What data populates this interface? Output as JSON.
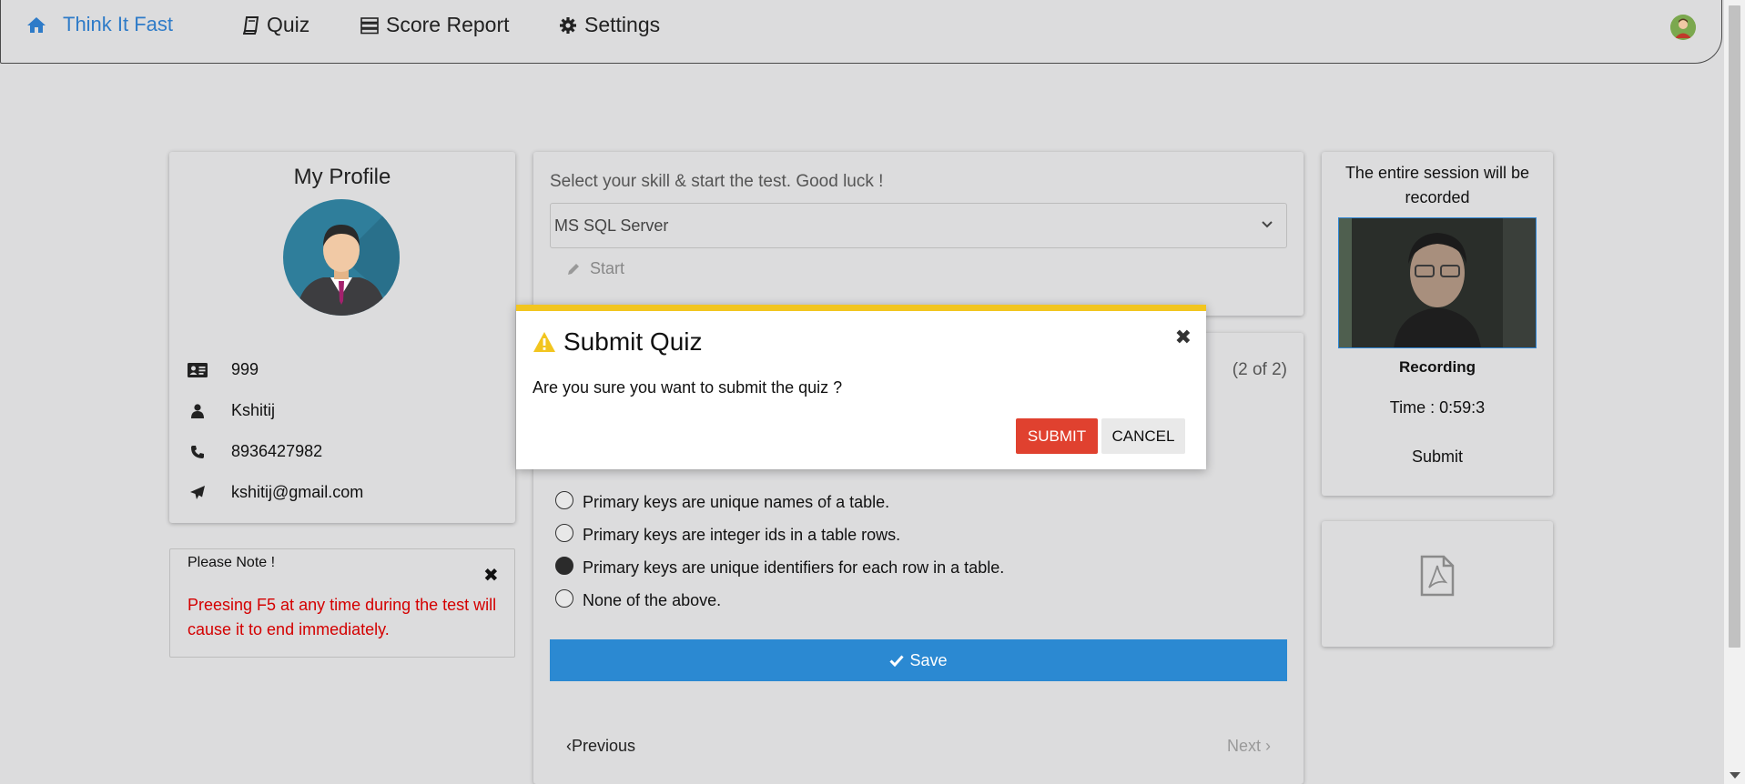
{
  "nav": {
    "brand": "Think It Fast",
    "quiz": "Quiz",
    "score_report": "Score Report",
    "settings": "Settings"
  },
  "profile": {
    "title": "My Profile",
    "id": "999",
    "name": "Kshitij",
    "phone": "8936427982",
    "email": "kshitij@gmail.com"
  },
  "note": {
    "title": "Please Note !",
    "close": "✖",
    "text": "Preesing F5 at any time during the test will cause it to end immediately."
  },
  "skill": {
    "label": "Select your skill & start the test. Good luck !",
    "selected": "MS SQL Server",
    "start": "Start"
  },
  "question": {
    "counter": "(2 of 2)",
    "options": [
      "Primary keys are unique names of a table.",
      "Primary keys are integer ids in a table rows.",
      "Primary keys are unique identifiers for each row in a table.",
      "None of the above."
    ],
    "selected_index": 2,
    "save": "Save",
    "previous": "Previous",
    "next": "Next"
  },
  "recording": {
    "title": "The entire session will be recorded",
    "label": "Recording",
    "time": "Time : 0:59:3",
    "submit": "Submit"
  },
  "modal": {
    "title": "Submit Quiz",
    "close": "✖",
    "body": "Are you sure you want to submit the quiz ?",
    "submit": "SUBMIT",
    "cancel": "CANCEL"
  },
  "colors": {
    "accent": "#2b89d2",
    "danger": "#e0412f",
    "warning": "#f2c51f",
    "note_text": "#d40000"
  }
}
